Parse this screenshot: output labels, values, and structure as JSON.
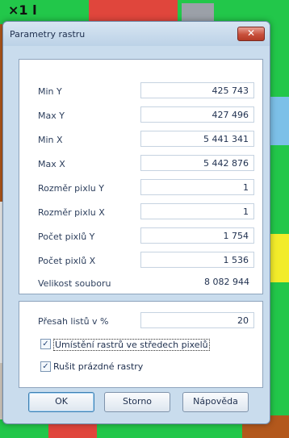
{
  "dialog": {
    "title": "Parametry rastru",
    "close_icon": "close-x-icon"
  },
  "fields": [
    {
      "label": "Min Y",
      "value": "425 743"
    },
    {
      "label": "Max Y",
      "value": "427 496"
    },
    {
      "label": "Min X",
      "value": "5 441 341"
    },
    {
      "label": "Max X",
      "value": "5 442 876"
    },
    {
      "label": "Rozměr pixlu Y",
      "value": "1"
    },
    {
      "label": "Rozměr pixlu X",
      "value": "1"
    },
    {
      "label": "Počet pixlů Y",
      "value": "1 754"
    },
    {
      "label": "Počet pixlů X",
      "value": "1 536"
    }
  ],
  "file_size": {
    "label": "Velikost souboru",
    "value": "8 082 944"
  },
  "overlap": {
    "label": "Přesah listů v %",
    "value": "20"
  },
  "options": [
    {
      "label": "Umístění rastrů ve středech pixelů",
      "checked": true
    },
    {
      "label": "Rušit prázdné rastry",
      "checked": true
    }
  ],
  "buttons": {
    "ok": "OK",
    "cancel": "Storno",
    "help": "Nápověda"
  },
  "colors": {
    "accent": "#3c7fb1",
    "dialog_bg": "#c9dced",
    "map_green": "#22c74a",
    "map_brown": "#b3581c",
    "map_red": "#e0463c",
    "map_yellow": "#f2ec2a"
  }
}
